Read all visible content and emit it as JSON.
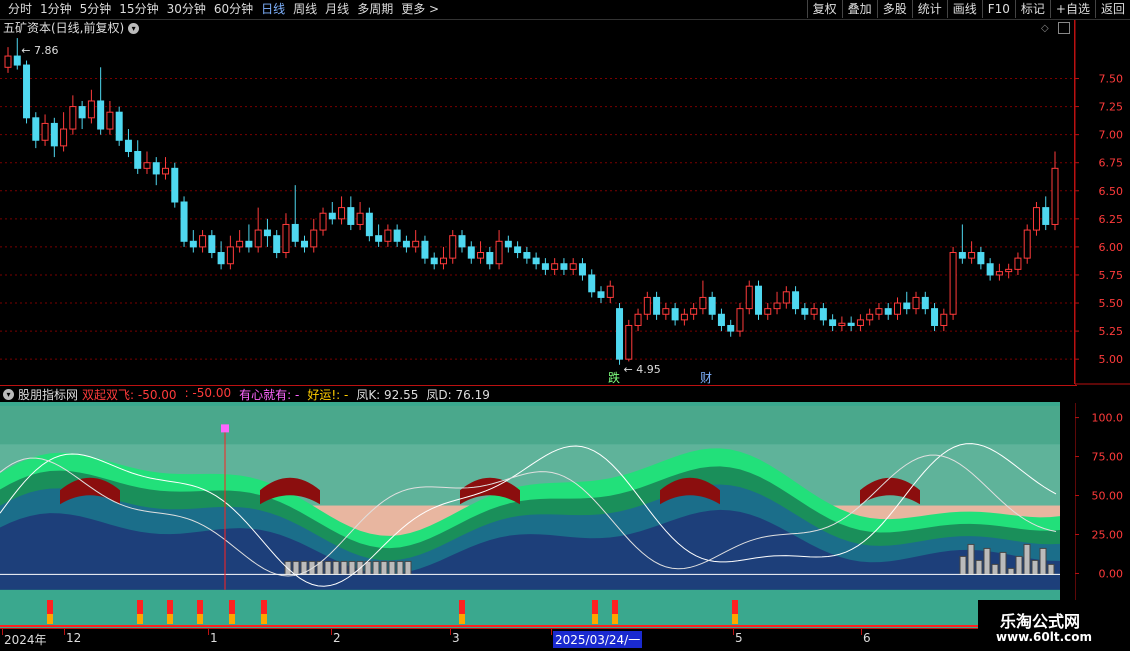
{
  "toolbar": {
    "periods": [
      "分时",
      "1分钟",
      "5分钟",
      "15分钟",
      "30分钟",
      "60分钟",
      "日线",
      "周线",
      "月线",
      "多周期",
      "更多 >"
    ],
    "active_period": "日线",
    "right_buttons": [
      "复权",
      "叠加",
      "多股",
      "统计",
      "画线",
      "F10",
      "标记",
      "+自选",
      "返回"
    ]
  },
  "chart_header": {
    "title": "五矿资本(日线,前复权)"
  },
  "indicator_header": {
    "name": "股朋指标网",
    "items": [
      {
        "text": "双起双飞: -50.00",
        "color": "#ff3b3b"
      },
      {
        "text": ": -50.00",
        "color": "#ff3b3b"
      },
      {
        "text": "有心就有: -",
        "color": "#ff66ff"
      },
      {
        "text": "好运!: -",
        "color": "#ffcc00"
      },
      {
        "text": "凤K: 92.55",
        "color": "#dddddd"
      },
      {
        "text": "凤D: 76.19",
        "color": "#dddddd"
      }
    ]
  },
  "price_axis": [
    "7.50",
    "7.25",
    "7.00",
    "6.75",
    "6.50",
    "6.25",
    "6.00",
    "5.75",
    "5.50",
    "5.25",
    "5.00"
  ],
  "indicator_axis": [
    "100.0",
    "75.00",
    "50.00",
    "25.00",
    "0.00"
  ],
  "annotations": {
    "high": "7.86",
    "low": "4.95",
    "markers": [
      "跌",
      "财"
    ]
  },
  "date_axis": [
    {
      "label": "2024年"
    },
    {
      "label": "12"
    },
    {
      "label": "1"
    },
    {
      "label": "2"
    },
    {
      "label": "3"
    },
    {
      "label": "2025/03/24/一"
    },
    {
      "label": "5"
    },
    {
      "label": "6"
    }
  ],
  "watermark": {
    "line1": "乐淘公式网",
    "line2": "www.60lt.com"
  },
  "colors": {
    "up": "#ff3b3b",
    "down": "#4fd8f0",
    "grid": "#7a0000",
    "teal": "#3aa88e"
  },
  "chart_data": {
    "type": "candlestick",
    "title": "五矿资本(日线,前复权)",
    "ylim": [
      4.85,
      7.95
    ],
    "points": [
      {
        "o": 7.6,
        "c": 7.7,
        "h": 7.78,
        "l": 7.55
      },
      {
        "o": 7.7,
        "c": 7.62,
        "h": 7.86,
        "l": 7.58
      },
      {
        "o": 7.62,
        "c": 7.15,
        "h": 7.66,
        "l": 7.1
      },
      {
        "o": 7.15,
        "c": 6.95,
        "h": 7.2,
        "l": 6.88
      },
      {
        "o": 6.95,
        "c": 7.1,
        "h": 7.18,
        "l": 6.9
      },
      {
        "o": 7.1,
        "c": 6.9,
        "h": 7.15,
        "l": 6.8
      },
      {
        "o": 6.9,
        "c": 7.05,
        "h": 7.2,
        "l": 6.85
      },
      {
        "o": 7.05,
        "c": 7.25,
        "h": 7.35,
        "l": 7.0
      },
      {
        "o": 7.25,
        "c": 7.15,
        "h": 7.3,
        "l": 7.05
      },
      {
        "o": 7.15,
        "c": 7.3,
        "h": 7.4,
        "l": 7.1
      },
      {
        "o": 7.3,
        "c": 7.05,
        "h": 7.6,
        "l": 7.0
      },
      {
        "o": 7.05,
        "c": 7.2,
        "h": 7.3,
        "l": 7.0
      },
      {
        "o": 7.2,
        "c": 6.95,
        "h": 7.25,
        "l": 6.9
      },
      {
        "o": 6.95,
        "c": 6.85,
        "h": 7.05,
        "l": 6.8
      },
      {
        "o": 6.85,
        "c": 6.7,
        "h": 6.95,
        "l": 6.65
      },
      {
        "o": 6.7,
        "c": 6.75,
        "h": 6.85,
        "l": 6.65
      },
      {
        "o": 6.75,
        "c": 6.65,
        "h": 6.8,
        "l": 6.55
      },
      {
        "o": 6.65,
        "c": 6.7,
        "h": 6.8,
        "l": 6.6
      },
      {
        "o": 6.7,
        "c": 6.4,
        "h": 6.75,
        "l": 6.35
      },
      {
        "o": 6.4,
        "c": 6.05,
        "h": 6.45,
        "l": 6.0
      },
      {
        "o": 6.05,
        "c": 6.0,
        "h": 6.15,
        "l": 5.95
      },
      {
        "o": 6.0,
        "c": 6.1,
        "h": 6.15,
        "l": 5.95
      },
      {
        "o": 6.1,
        "c": 5.95,
        "h": 6.15,
        "l": 5.9
      },
      {
        "o": 5.95,
        "c": 5.85,
        "h": 6.05,
        "l": 5.8
      },
      {
        "o": 5.85,
        "c": 6.0,
        "h": 6.1,
        "l": 5.8
      },
      {
        "o": 6.0,
        "c": 6.05,
        "h": 6.15,
        "l": 5.95
      },
      {
        "o": 6.05,
        "c": 6.0,
        "h": 6.2,
        "l": 5.95
      },
      {
        "o": 6.0,
        "c": 6.15,
        "h": 6.35,
        "l": 5.95
      },
      {
        "o": 6.15,
        "c": 6.1,
        "h": 6.25,
        "l": 6.0
      },
      {
        "o": 6.1,
        "c": 5.95,
        "h": 6.15,
        "l": 5.9
      },
      {
        "o": 5.95,
        "c": 6.2,
        "h": 6.3,
        "l": 5.9
      },
      {
        "o": 6.2,
        "c": 6.05,
        "h": 6.55,
        "l": 6.0
      },
      {
        "o": 6.05,
        "c": 6.0,
        "h": 6.1,
        "l": 5.95
      },
      {
        "o": 6.0,
        "c": 6.15,
        "h": 6.25,
        "l": 5.95
      },
      {
        "o": 6.15,
        "c": 6.3,
        "h": 6.35,
        "l": 6.1
      },
      {
        "o": 6.3,
        "c": 6.25,
        "h": 6.4,
        "l": 6.2
      },
      {
        "o": 6.25,
        "c": 6.35,
        "h": 6.45,
        "l": 6.2
      },
      {
        "o": 6.35,
        "c": 6.2,
        "h": 6.45,
        "l": 6.15
      },
      {
        "o": 6.2,
        "c": 6.3,
        "h": 6.4,
        "l": 6.15
      },
      {
        "o": 6.3,
        "c": 6.1,
        "h": 6.35,
        "l": 6.05
      },
      {
        "o": 6.1,
        "c": 6.05,
        "h": 6.2,
        "l": 6.0
      },
      {
        "o": 6.05,
        "c": 6.15,
        "h": 6.2,
        "l": 6.0
      },
      {
        "o": 6.15,
        "c": 6.05,
        "h": 6.2,
        "l": 6.0
      },
      {
        "o": 6.05,
        "c": 6.0,
        "h": 6.1,
        "l": 5.95
      },
      {
        "o": 6.0,
        "c": 6.05,
        "h": 6.15,
        "l": 5.95
      },
      {
        "o": 6.05,
        "c": 5.9,
        "h": 6.1,
        "l": 5.85
      },
      {
        "o": 5.9,
        "c": 5.85,
        "h": 5.95,
        "l": 5.8
      },
      {
        "o": 5.85,
        "c": 5.9,
        "h": 6.0,
        "l": 5.8
      },
      {
        "o": 5.9,
        "c": 6.1,
        "h": 6.15,
        "l": 5.85
      },
      {
        "o": 6.1,
        "c": 6.0,
        "h": 6.15,
        "l": 5.95
      },
      {
        "o": 6.0,
        "c": 5.9,
        "h": 6.05,
        "l": 5.85
      },
      {
        "o": 5.9,
        "c": 5.95,
        "h": 6.05,
        "l": 5.85
      },
      {
        "o": 5.95,
        "c": 5.85,
        "h": 6.0,
        "l": 5.8
      },
      {
        "o": 5.85,
        "c": 6.05,
        "h": 6.15,
        "l": 5.8
      },
      {
        "o": 6.05,
        "c": 6.0,
        "h": 6.1,
        "l": 5.95
      },
      {
        "o": 6.0,
        "c": 5.95,
        "h": 6.05,
        "l": 5.9
      },
      {
        "o": 5.95,
        "c": 5.9,
        "h": 6.0,
        "l": 5.85
      },
      {
        "o": 5.9,
        "c": 5.85,
        "h": 5.95,
        "l": 5.8
      },
      {
        "o": 5.85,
        "c": 5.8,
        "h": 5.9,
        "l": 5.75
      },
      {
        "o": 5.8,
        "c": 5.85,
        "h": 5.9,
        "l": 5.75
      },
      {
        "o": 5.85,
        "c": 5.8,
        "h": 5.9,
        "l": 5.75
      },
      {
        "o": 5.8,
        "c": 5.85,
        "h": 5.9,
        "l": 5.75
      },
      {
        "o": 5.85,
        "c": 5.75,
        "h": 5.9,
        "l": 5.7
      },
      {
        "o": 5.75,
        "c": 5.6,
        "h": 5.8,
        "l": 5.55
      },
      {
        "o": 5.6,
        "c": 5.55,
        "h": 5.65,
        "l": 5.5
      },
      {
        "o": 5.55,
        "c": 5.65,
        "h": 5.7,
        "l": 5.5
      },
      {
        "o": 5.45,
        "c": 5.0,
        "h": 5.5,
        "l": 4.95
      },
      {
        "o": 5.0,
        "c": 5.3,
        "h": 5.35,
        "l": 4.98
      },
      {
        "o": 5.3,
        "c": 5.4,
        "h": 5.45,
        "l": 5.25
      },
      {
        "o": 5.4,
        "c": 5.55,
        "h": 5.6,
        "l": 5.35
      },
      {
        "o": 5.55,
        "c": 5.4,
        "h": 5.6,
        "l": 5.35
      },
      {
        "o": 5.4,
        "c": 5.45,
        "h": 5.5,
        "l": 5.35
      },
      {
        "o": 5.45,
        "c": 5.35,
        "h": 5.5,
        "l": 5.3
      },
      {
        "o": 5.35,
        "c": 5.4,
        "h": 5.45,
        "l": 5.3
      },
      {
        "o": 5.4,
        "c": 5.45,
        "h": 5.5,
        "l": 5.35
      },
      {
        "o": 5.45,
        "c": 5.55,
        "h": 5.7,
        "l": 5.4
      },
      {
        "o": 5.55,
        "c": 5.4,
        "h": 5.6,
        "l": 5.35
      },
      {
        "o": 5.4,
        "c": 5.3,
        "h": 5.45,
        "l": 5.25
      },
      {
        "o": 5.3,
        "c": 5.25,
        "h": 5.35,
        "l": 5.2
      },
      {
        "o": 5.25,
        "c": 5.45,
        "h": 5.5,
        "l": 5.2
      },
      {
        "o": 5.45,
        "c": 5.65,
        "h": 5.7,
        "l": 5.4
      },
      {
        "o": 5.65,
        "c": 5.4,
        "h": 5.7,
        "l": 5.35
      },
      {
        "o": 5.4,
        "c": 5.45,
        "h": 5.5,
        "l": 5.35
      },
      {
        "o": 5.45,
        "c": 5.5,
        "h": 5.6,
        "l": 5.4
      },
      {
        "o": 5.5,
        "c": 5.6,
        "h": 5.65,
        "l": 5.45
      },
      {
        "o": 5.6,
        "c": 5.45,
        "h": 5.65,
        "l": 5.4
      },
      {
        "o": 5.45,
        "c": 5.4,
        "h": 5.5,
        "l": 5.35
      },
      {
        "o": 5.4,
        "c": 5.45,
        "h": 5.5,
        "l": 5.35
      },
      {
        "o": 5.45,
        "c": 5.35,
        "h": 5.5,
        "l": 5.3
      },
      {
        "o": 5.35,
        "c": 5.3,
        "h": 5.4,
        "l": 5.25
      },
      {
        "o": 5.3,
        "c": 5.32,
        "h": 5.38,
        "l": 5.25
      },
      {
        "o": 5.32,
        "c": 5.3,
        "h": 5.38,
        "l": 5.25
      },
      {
        "o": 5.3,
        "c": 5.35,
        "h": 5.4,
        "l": 5.25
      },
      {
        "o": 5.35,
        "c": 5.4,
        "h": 5.45,
        "l": 5.3
      },
      {
        "o": 5.4,
        "c": 5.45,
        "h": 5.5,
        "l": 5.35
      },
      {
        "o": 5.45,
        "c": 5.4,
        "h": 5.5,
        "l": 5.35
      },
      {
        "o": 5.4,
        "c": 5.5,
        "h": 5.55,
        "l": 5.35
      },
      {
        "o": 5.5,
        "c": 5.45,
        "h": 5.6,
        "l": 5.4
      },
      {
        "o": 5.45,
        "c": 5.55,
        "h": 5.6,
        "l": 5.4
      },
      {
        "o": 5.55,
        "c": 5.45,
        "h": 5.6,
        "l": 5.4
      },
      {
        "o": 5.45,
        "c": 5.3,
        "h": 5.5,
        "l": 5.25
      },
      {
        "o": 5.3,
        "c": 5.4,
        "h": 5.45,
        "l": 5.25
      },
      {
        "o": 5.4,
        "c": 5.95,
        "h": 6.0,
        "l": 5.35
      },
      {
        "o": 5.95,
        "c": 5.9,
        "h": 6.2,
        "l": 5.85
      },
      {
        "o": 5.9,
        "c": 5.95,
        "h": 6.05,
        "l": 5.85
      },
      {
        "o": 5.95,
        "c": 5.85,
        "h": 6.0,
        "l": 5.8
      },
      {
        "o": 5.85,
        "c": 5.75,
        "h": 5.9,
        "l": 5.7
      },
      {
        "o": 5.75,
        "c": 5.78,
        "h": 5.85,
        "l": 5.7
      },
      {
        "o": 5.78,
        "c": 5.8,
        "h": 5.85,
        "l": 5.72
      },
      {
        "o": 5.8,
        "c": 5.9,
        "h": 5.95,
        "l": 5.75
      },
      {
        "o": 5.9,
        "c": 6.15,
        "h": 6.2,
        "l": 5.85
      },
      {
        "o": 6.15,
        "c": 6.35,
        "h": 6.4,
        "l": 6.1
      },
      {
        "o": 6.35,
        "c": 6.2,
        "h": 6.45,
        "l": 6.15
      },
      {
        "o": 6.2,
        "c": 6.7,
        "h": 6.85,
        "l": 6.15
      }
    ],
    "indicator": {
      "name": "股朋指标网",
      "K": 92.55,
      "D": 76.19,
      "ylim": [
        -35,
        110
      ]
    }
  }
}
